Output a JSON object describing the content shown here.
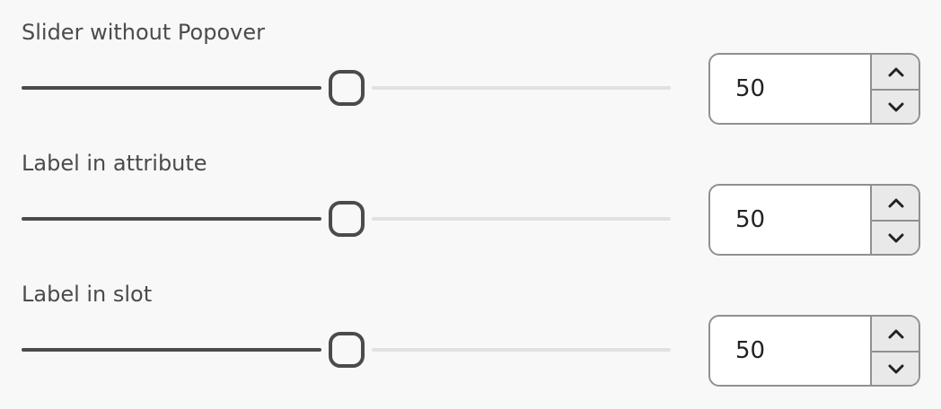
{
  "sliders": [
    {
      "label": "Slider without Popover",
      "value": "50",
      "percent": 50
    },
    {
      "label": "Label in attribute",
      "value": "50",
      "percent": 50
    },
    {
      "label": "Label in slot",
      "value": "50",
      "percent": 50
    }
  ],
  "icons": {
    "up": "chevron-up-icon",
    "down": "chevron-down-icon"
  }
}
